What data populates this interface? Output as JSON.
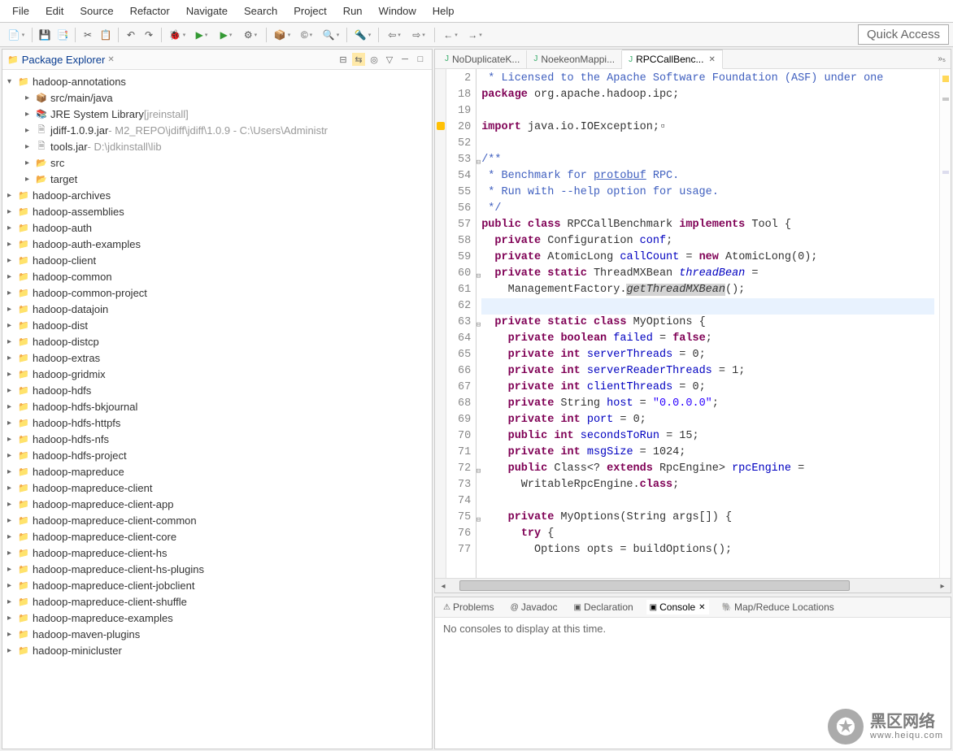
{
  "menubar": [
    "File",
    "Edit",
    "Source",
    "Refactor",
    "Navigate",
    "Search",
    "Project",
    "Run",
    "Window",
    "Help"
  ],
  "quick_access": "Quick Access",
  "package_explorer": {
    "title": "Package Explorer",
    "tree": [
      {
        "indent": 0,
        "exp": "▾",
        "icon": "proj",
        "label": "hadoop-annotations",
        "suffix": ""
      },
      {
        "indent": 1,
        "exp": "▸",
        "icon": "pkg",
        "label": "src/main/java",
        "suffix": ""
      },
      {
        "indent": 1,
        "exp": "▸",
        "icon": "lib",
        "label": "JRE System Library",
        "suffix": " [jreinstall]"
      },
      {
        "indent": 1,
        "exp": "▸",
        "icon": "jar",
        "label": "jdiff-1.0.9.jar",
        "suffix": " - M2_REPO\\jdiff\\jdiff\\1.0.9 - C:\\Users\\Administr"
      },
      {
        "indent": 1,
        "exp": "▸",
        "icon": "jar",
        "label": "tools.jar",
        "suffix": " - D:\\jdkinstall\\lib"
      },
      {
        "indent": 1,
        "exp": "▸",
        "icon": "folder",
        "label": "src",
        "suffix": ""
      },
      {
        "indent": 1,
        "exp": "▸",
        "icon": "folder",
        "label": "target",
        "suffix": ""
      },
      {
        "indent": 0,
        "exp": "▸",
        "icon": "proj",
        "label": "hadoop-archives",
        "suffix": ""
      },
      {
        "indent": 0,
        "exp": "▸",
        "icon": "proj",
        "label": "hadoop-assemblies",
        "suffix": ""
      },
      {
        "indent": 0,
        "exp": "▸",
        "icon": "proj",
        "label": "hadoop-auth",
        "suffix": ""
      },
      {
        "indent": 0,
        "exp": "▸",
        "icon": "proj",
        "label": "hadoop-auth-examples",
        "suffix": ""
      },
      {
        "indent": 0,
        "exp": "▸",
        "icon": "proj",
        "label": "hadoop-client",
        "suffix": ""
      },
      {
        "indent": 0,
        "exp": "▸",
        "icon": "proj",
        "label": "hadoop-common",
        "suffix": ""
      },
      {
        "indent": 0,
        "exp": "▸",
        "icon": "proj",
        "label": "hadoop-common-project",
        "suffix": ""
      },
      {
        "indent": 0,
        "exp": "▸",
        "icon": "proj",
        "label": "hadoop-datajoin",
        "suffix": ""
      },
      {
        "indent": 0,
        "exp": "▸",
        "icon": "proj",
        "label": "hadoop-dist",
        "suffix": ""
      },
      {
        "indent": 0,
        "exp": "▸",
        "icon": "proj",
        "label": "hadoop-distcp",
        "suffix": ""
      },
      {
        "indent": 0,
        "exp": "▸",
        "icon": "proj",
        "label": "hadoop-extras",
        "suffix": ""
      },
      {
        "indent": 0,
        "exp": "▸",
        "icon": "proj",
        "label": "hadoop-gridmix",
        "suffix": ""
      },
      {
        "indent": 0,
        "exp": "▸",
        "icon": "proj",
        "label": "hadoop-hdfs",
        "suffix": ""
      },
      {
        "indent": 0,
        "exp": "▸",
        "icon": "proj",
        "label": "hadoop-hdfs-bkjournal",
        "suffix": ""
      },
      {
        "indent": 0,
        "exp": "▸",
        "icon": "proj",
        "label": "hadoop-hdfs-httpfs",
        "suffix": ""
      },
      {
        "indent": 0,
        "exp": "▸",
        "icon": "proj",
        "label": "hadoop-hdfs-nfs",
        "suffix": ""
      },
      {
        "indent": 0,
        "exp": "▸",
        "icon": "proj",
        "label": "hadoop-hdfs-project",
        "suffix": ""
      },
      {
        "indent": 0,
        "exp": "▸",
        "icon": "proj",
        "label": "hadoop-mapreduce",
        "suffix": ""
      },
      {
        "indent": 0,
        "exp": "▸",
        "icon": "proj",
        "label": "hadoop-mapreduce-client",
        "suffix": ""
      },
      {
        "indent": 0,
        "exp": "▸",
        "icon": "proj",
        "label": "hadoop-mapreduce-client-app",
        "suffix": ""
      },
      {
        "indent": 0,
        "exp": "▸",
        "icon": "proj",
        "label": "hadoop-mapreduce-client-common",
        "suffix": ""
      },
      {
        "indent": 0,
        "exp": "▸",
        "icon": "proj",
        "label": "hadoop-mapreduce-client-core",
        "suffix": ""
      },
      {
        "indent": 0,
        "exp": "▸",
        "icon": "proj",
        "label": "hadoop-mapreduce-client-hs",
        "suffix": ""
      },
      {
        "indent": 0,
        "exp": "▸",
        "icon": "proj",
        "label": "hadoop-mapreduce-client-hs-plugins",
        "suffix": ""
      },
      {
        "indent": 0,
        "exp": "▸",
        "icon": "proj",
        "label": "hadoop-mapreduce-client-jobclient",
        "suffix": ""
      },
      {
        "indent": 0,
        "exp": "▸",
        "icon": "proj",
        "label": "hadoop-mapreduce-client-shuffle",
        "suffix": ""
      },
      {
        "indent": 0,
        "exp": "▸",
        "icon": "proj",
        "label": "hadoop-mapreduce-examples",
        "suffix": ""
      },
      {
        "indent": 0,
        "exp": "▸",
        "icon": "proj",
        "label": "hadoop-maven-plugins",
        "suffix": ""
      },
      {
        "indent": 0,
        "exp": "▸",
        "icon": "proj",
        "label": "hadoop-minicluster",
        "suffix": ""
      }
    ]
  },
  "editor_tabs": [
    {
      "label": "NoDuplicateK...",
      "active": false
    },
    {
      "label": "NoekeonMappi...",
      "active": false
    },
    {
      "label": "RPCCallBenc...",
      "active": true
    }
  ],
  "code_lines": [
    {
      "n": "2",
      "m": "foldp",
      "html": "<span class='doc'> * Licensed to the Apache Software Foundation (ASF) under one</span>"
    },
    {
      "n": "18",
      "html": "<span class='kw'>package</span> org.apache.hadoop.ipc;"
    },
    {
      "n": "19",
      "html": ""
    },
    {
      "n": "20",
      "m": "foldp",
      "marker": "warn",
      "html": "<span class='kw'>import</span> java.io.IOException;▫"
    },
    {
      "n": "52",
      "html": ""
    },
    {
      "n": "53",
      "m": "fold",
      "html": "<span class='doc'>/**</span>"
    },
    {
      "n": "54",
      "html": "<span class='doc'> * Benchmark for <u>protobuf</u> RPC.</span>"
    },
    {
      "n": "55",
      "html": "<span class='doc'> * Run with --help option for usage.</span>"
    },
    {
      "n": "56",
      "html": "<span class='doc'> */</span>"
    },
    {
      "n": "57",
      "html": "<span class='kw'>public</span> <span class='kw'>class</span> RPCCallBenchmark <span class='kw'>implements</span> Tool {"
    },
    {
      "n": "58",
      "html": "  <span class='kw'>private</span> Configuration <span class='fld'>conf</span>;"
    },
    {
      "n": "59",
      "html": "  <span class='kw'>private</span> AtomicLong <span class='fld'>callCount</span> = <span class='kw'>new</span> AtomicLong(0);"
    },
    {
      "n": "60",
      "m": "fold",
      "html": "  <span class='kw'>private</span> <span class='kw'>static</span> ThreadMXBean <span class='fld-i'>threadBean</span> ="
    },
    {
      "n": "61",
      "html": "    ManagementFactory.<span class='bg-occ'><i>getThreadMXBean</i></span>();"
    },
    {
      "n": "62",
      "hl": true,
      "html": ""
    },
    {
      "n": "63",
      "m": "fold",
      "html": "  <span class='kw'>private</span> <span class='kw'>static</span> <span class='kw'>class</span> MyOptions {"
    },
    {
      "n": "64",
      "html": "    <span class='kw'>private</span> <span class='kw'>boolean</span> <span class='fld'>failed</span> = <span class='kw'>false</span>;"
    },
    {
      "n": "65",
      "html": "    <span class='kw'>private</span> <span class='kw'>int</span> <span class='fld'>serverThreads</span> = 0;"
    },
    {
      "n": "66",
      "html": "    <span class='kw'>private</span> <span class='kw'>int</span> <span class='fld'>serverReaderThreads</span> = 1;"
    },
    {
      "n": "67",
      "html": "    <span class='kw'>private</span> <span class='kw'>int</span> <span class='fld'>clientThreads</span> = 0;"
    },
    {
      "n": "68",
      "html": "    <span class='kw'>private</span> String <span class='fld'>host</span> = <span class='str'>\"0.0.0.0\"</span>;"
    },
    {
      "n": "69",
      "html": "    <span class='kw'>private</span> <span class='kw'>int</span> <span class='fld'>port</span> = 0;"
    },
    {
      "n": "70",
      "html": "    <span class='kw'>public</span> <span class='kw'>int</span> <span class='fld'>secondsToRun</span> = 15;"
    },
    {
      "n": "71",
      "html": "    <span class='kw'>private</span> <span class='kw'>int</span> <span class='fld'>msgSize</span> = 1024;"
    },
    {
      "n": "72",
      "m": "fold",
      "html": "    <span class='kw'>public</span> Class&lt;? <span class='kw'>extends</span> RpcEngine&gt; <span class='fld'>rpcEngine</span> ="
    },
    {
      "n": "73",
      "html": "      WritableRpcEngine.<span class='kw'>class</span>;"
    },
    {
      "n": "74",
      "html": ""
    },
    {
      "n": "75",
      "m": "fold",
      "html": "    <span class='kw'>private</span> MyOptions(String args[]) {"
    },
    {
      "n": "76",
      "html": "      <span class='kw'>try</span> {"
    },
    {
      "n": "77",
      "html": "        Options opts = buildOptions();"
    }
  ],
  "bottom_tabs": [
    {
      "label": "Problems",
      "icon": "⚠"
    },
    {
      "label": "Javadoc",
      "icon": "@"
    },
    {
      "label": "Declaration",
      "icon": "▣"
    },
    {
      "label": "Console",
      "icon": "▣",
      "active": true
    },
    {
      "label": "Map/Reduce Locations",
      "icon": "🐘"
    }
  ],
  "console_msg": "No consoles to display at this time.",
  "watermark": {
    "title": "黑区网络",
    "url": "www.heiqu.com"
  }
}
